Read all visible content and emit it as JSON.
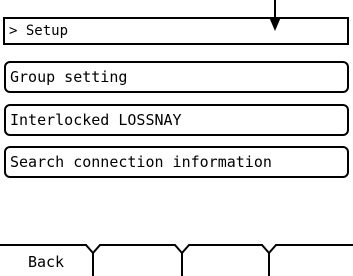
{
  "header": {
    "title": "> Setup"
  },
  "menu": {
    "items": [
      {
        "label": "Group setting"
      },
      {
        "label": "Interlocked LOSSNAY"
      },
      {
        "label": "Search connection information"
      }
    ]
  },
  "footer": {
    "keys": [
      {
        "label": "Back"
      },
      {
        "label": ""
      },
      {
        "label": ""
      },
      {
        "label": ""
      }
    ]
  },
  "indicator": {
    "icon": "down-arrow-icon"
  }
}
